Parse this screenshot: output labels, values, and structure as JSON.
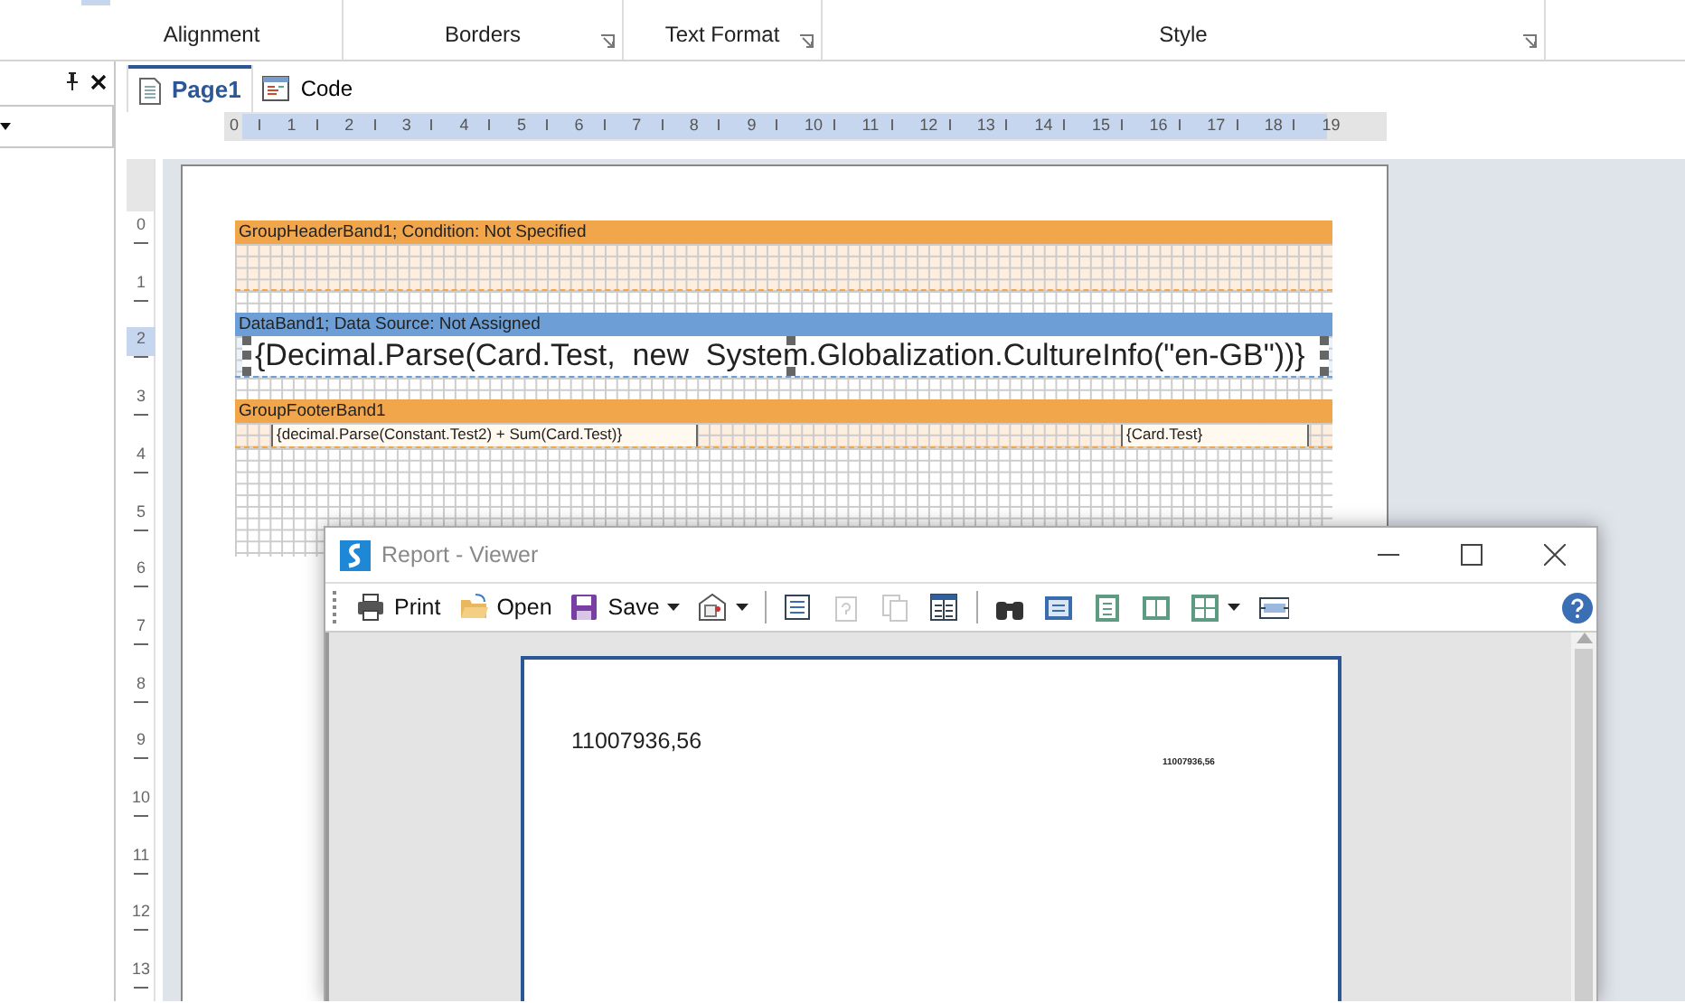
{
  "ribbon": {
    "groups": [
      {
        "label": "Alignment",
        "launcher": false
      },
      {
        "label": "Borders",
        "launcher": true
      },
      {
        "label": "Text Format",
        "launcher": true
      },
      {
        "label": "Style",
        "launcher": true
      }
    ]
  },
  "tabs": [
    {
      "label": "Page1",
      "selected": true
    },
    {
      "label": "Code",
      "selected": false
    }
  ],
  "horizontal_ruler": [
    "0",
    "1",
    "2",
    "3",
    "4",
    "5",
    "6",
    "7",
    "8",
    "9",
    "10",
    "11",
    "12",
    "13",
    "14",
    "15",
    "16",
    "17",
    "18",
    "19"
  ],
  "vertical_ruler": [
    {
      "label": "0",
      "selected": false
    },
    {
      "label": "1",
      "selected": false
    },
    {
      "label": "2",
      "selected": true
    },
    {
      "label": "3",
      "selected": false
    },
    {
      "label": "4",
      "selected": false
    },
    {
      "label": "5",
      "selected": false
    },
    {
      "label": "6",
      "selected": false
    },
    {
      "label": "7",
      "selected": false
    },
    {
      "label": "8",
      "selected": false
    },
    {
      "label": "9",
      "selected": false
    },
    {
      "label": "10",
      "selected": false
    },
    {
      "label": "11",
      "selected": false
    },
    {
      "label": "12",
      "selected": false
    },
    {
      "label": "13",
      "selected": false
    }
  ],
  "bands": [
    {
      "kind": "header",
      "title": "GroupHeaderBand1; Condition: Not Specified"
    },
    {
      "kind": "data",
      "title": "DataBand1; Data Source: Not Assigned",
      "fields": [
        {
          "text": "{Decimal.Parse(Card.Test,  new  System.Globalization.CultureInfo(\"en-GB\"))}",
          "selected": true
        }
      ]
    },
    {
      "kind": "footer",
      "title": "GroupFooterBand1",
      "fields": [
        {
          "text": "{decimal.Parse(Constant.Test2) + Sum(Card.Test)}",
          "selected": false
        },
        {
          "text": "{Card.Test}",
          "selected": false
        }
      ]
    }
  ],
  "viewer": {
    "title": "Report - Viewer",
    "toolbar": [
      {
        "kind": "button",
        "label": "Print",
        "disabled": false,
        "dropdown": false
      },
      {
        "kind": "button",
        "label": "Open",
        "disabled": false,
        "dropdown": false
      },
      {
        "kind": "button",
        "label": "Save",
        "disabled": false,
        "dropdown": true
      },
      {
        "kind": "button",
        "disabled": false,
        "dropdown": true
      },
      {
        "kind": "separator"
      },
      {
        "kind": "button",
        "disabled": false,
        "dropdown": false
      },
      {
        "kind": "button",
        "disabled": true,
        "dropdown": false
      },
      {
        "kind": "button",
        "disabled": true,
        "dropdown": false
      },
      {
        "kind": "button",
        "disabled": false,
        "dropdown": false
      },
      {
        "kind": "separator"
      },
      {
        "kind": "button",
        "disabled": false,
        "dropdown": false
      },
      {
        "kind": "button",
        "disabled": false,
        "dropdown": false
      },
      {
        "kind": "button",
        "disabled": false,
        "dropdown": false
      },
      {
        "kind": "button",
        "disabled": false,
        "dropdown": false
      },
      {
        "kind": "button",
        "disabled": false,
        "dropdown": true
      },
      {
        "kind": "button",
        "disabled": false,
        "dropdown": false
      }
    ],
    "page_texts": [
      "11007936,56",
      "11007936,56"
    ]
  }
}
